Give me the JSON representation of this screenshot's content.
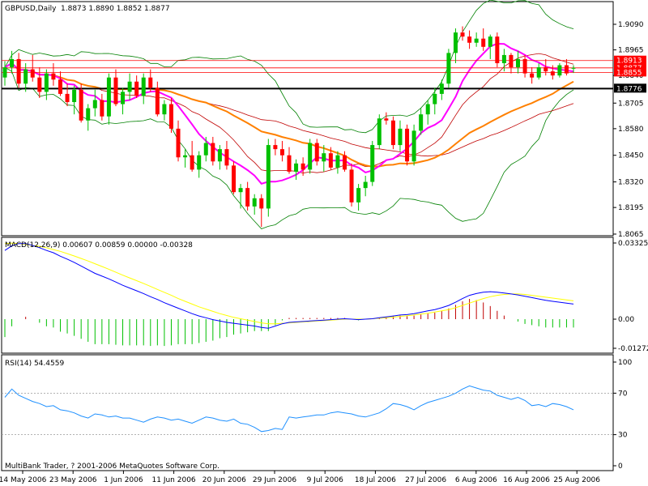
{
  "header": {
    "symbol_label": "GBPUSD,Daily",
    "ohlc_text": "1.8873 1.8890 1.8852 1.8877"
  },
  "footer": {
    "copyright": "MultiBank Trader, ? 2001-2006 MetaQuotes Software Corp."
  },
  "colors": {
    "background": "#ffffff",
    "bull": "#00c000",
    "bear": "#ff0000",
    "bb": "#008000",
    "ma_green": "#008000",
    "ma_magenta": "#ff00ff",
    "ma_orange": "#ff8000",
    "ma_red": "#c00000",
    "macd": "#0000ff",
    "signal": "#ffff00",
    "rsi": "#1e90ff",
    "hline": "#ff0000"
  },
  "chart_data": [
    {
      "type": "candlestick",
      "ylim": [
        1.8065,
        1.909
      ],
      "y_ticks": [
        "1.9090",
        "1.8965",
        "1.8840",
        "1.8705",
        "1.8580",
        "1.8450",
        "1.8320",
        "1.8195",
        "1.8065"
      ],
      "price_tags": {
        "top_red": "1.8913",
        "partial": "1.8877",
        "bottom_red": "1.8855",
        "black": "1.8776"
      },
      "red_lines": [
        1.8913,
        1.8877,
        1.8855
      ],
      "black_line": 1.8776,
      "x_dates": [
        "14 May 2006",
        "23 May 2006",
        "1 Jun 2006",
        "11 Jun 2006",
        "20 Jun 2006",
        "29 Jun 2006",
        "9 Jul 2006",
        "18 Jul 2006",
        "27 Jul 2006",
        "6 Aug 2006",
        "16 Aug 2006",
        "25 Aug 2006"
      ],
      "candles": [
        [
          1.883,
          1.891,
          1.879,
          1.888
        ],
        [
          1.888,
          1.896,
          1.885,
          1.892
        ],
        [
          1.892,
          1.895,
          1.878,
          1.88
        ],
        [
          1.88,
          1.89,
          1.876,
          1.887
        ],
        [
          1.887,
          1.894,
          1.881,
          1.883
        ],
        [
          1.883,
          1.888,
          1.873,
          1.876
        ],
        [
          1.876,
          1.887,
          1.872,
          1.885
        ],
        [
          1.885,
          1.89,
          1.879,
          1.882
        ],
        [
          1.882,
          1.886,
          1.874,
          1.875
        ],
        [
          1.875,
          1.88,
          1.869,
          1.871
        ],
        [
          1.871,
          1.879,
          1.865,
          1.877
        ],
        [
          1.877,
          1.88,
          1.861,
          1.862
        ],
        [
          1.862,
          1.87,
          1.857,
          1.868
        ],
        [
          1.868,
          1.877,
          1.864,
          1.872
        ],
        [
          1.872,
          1.875,
          1.862,
          1.864
        ],
        [
          1.864,
          1.885,
          1.86,
          1.883
        ],
        [
          1.883,
          1.887,
          1.869,
          1.87
        ],
        [
          1.87,
          1.878,
          1.865,
          1.876
        ],
        [
          1.876,
          1.885,
          1.872,
          1.881
        ],
        [
          1.881,
          1.884,
          1.873,
          1.874
        ],
        [
          1.874,
          1.885,
          1.87,
          1.883
        ],
        [
          1.883,
          1.887,
          1.876,
          1.878
        ],
        [
          1.878,
          1.881,
          1.864,
          1.865
        ],
        [
          1.865,
          1.872,
          1.862,
          1.87
        ],
        [
          1.87,
          1.873,
          1.856,
          1.858
        ],
        [
          1.858,
          1.862,
          1.842,
          1.844
        ],
        [
          1.844,
          1.848,
          1.839,
          1.845
        ],
        [
          1.845,
          1.852,
          1.837,
          1.838
        ],
        [
          1.838,
          1.847,
          1.834,
          1.845
        ],
        [
          1.845,
          1.854,
          1.842,
          1.851
        ],
        [
          1.851,
          1.854,
          1.84,
          1.842
        ],
        [
          1.842,
          1.85,
          1.838,
          1.848
        ],
        [
          1.848,
          1.852,
          1.838,
          1.84
        ],
        [
          1.84,
          1.842,
          1.826,
          1.827
        ],
        [
          1.827,
          1.831,
          1.819,
          1.829
        ],
        [
          1.829,
          1.832,
          1.818,
          1.82
        ],
        [
          1.82,
          1.826,
          1.816,
          1.824
        ],
        [
          1.824,
          1.826,
          1.81,
          1.819
        ],
        [
          1.819,
          1.853,
          1.815,
          1.85
        ],
        [
          1.85,
          1.853,
          1.845,
          1.848
        ],
        [
          1.848,
          1.852,
          1.842,
          1.845
        ],
        [
          1.845,
          1.849,
          1.836,
          1.837
        ],
        [
          1.837,
          1.843,
          1.833,
          1.841
        ],
        [
          1.841,
          1.844,
          1.835,
          1.838
        ],
        [
          1.838,
          1.853,
          1.836,
          1.851
        ],
        [
          1.851,
          1.853,
          1.84,
          1.842
        ],
        [
          1.842,
          1.85,
          1.837,
          1.846
        ],
        [
          1.846,
          1.849,
          1.838,
          1.839
        ],
        [
          1.839,
          1.847,
          1.836,
          1.845
        ],
        [
          1.845,
          1.847,
          1.837,
          1.838
        ],
        [
          1.838,
          1.841,
          1.82,
          1.822
        ],
        [
          1.822,
          1.831,
          1.818,
          1.829
        ],
        [
          1.829,
          1.835,
          1.825,
          1.832
        ],
        [
          1.832,
          1.852,
          1.83,
          1.85
        ],
        [
          1.85,
          1.865,
          1.848,
          1.863
        ],
        [
          1.863,
          1.866,
          1.86,
          1.862
        ],
        [
          1.862,
          1.864,
          1.848,
          1.85
        ],
        [
          1.85,
          1.862,
          1.847,
          1.858
        ],
        [
          1.858,
          1.86,
          1.84,
          1.842
        ],
        [
          1.842,
          1.86,
          1.84,
          1.857
        ],
        [
          1.857,
          1.868,
          1.855,
          1.865
        ],
        [
          1.865,
          1.872,
          1.86,
          1.87
        ],
        [
          1.87,
          1.878,
          1.865,
          1.875
        ],
        [
          1.875,
          1.882,
          1.872,
          1.88
        ],
        [
          1.88,
          1.897,
          1.878,
          1.895
        ],
        [
          1.895,
          1.907,
          1.89,
          1.905
        ],
        [
          1.905,
          1.908,
          1.901,
          1.903
        ],
        [
          1.903,
          1.906,
          1.897,
          1.9
        ],
        [
          1.9,
          1.905,
          1.898,
          1.902
        ],
        [
          1.902,
          1.907,
          1.896,
          1.898
        ],
        [
          1.898,
          1.904,
          1.892,
          1.903
        ],
        [
          1.903,
          1.905,
          1.888,
          1.89
        ],
        [
          1.89,
          1.897,
          1.886,
          1.894
        ],
        [
          1.894,
          1.895,
          1.885,
          1.888
        ],
        [
          1.888,
          1.896,
          1.885,
          1.892
        ],
        [
          1.892,
          1.894,
          1.883,
          1.885
        ],
        [
          1.885,
          1.888,
          1.88,
          1.883
        ],
        [
          1.883,
          1.89,
          1.882,
          1.888
        ],
        [
          1.888,
          1.892,
          1.884,
          1.886
        ],
        [
          1.886,
          1.889,
          1.882,
          1.884
        ],
        [
          1.884,
          1.89,
          1.883,
          1.889
        ],
        [
          1.889,
          1.892,
          1.884,
          1.885
        ],
        [
          1.8873,
          1.889,
          1.8852,
          1.8877
        ]
      ]
    },
    {
      "type": "line",
      "title": "MACD(12,26,9) 0.00607 0.00859 0.00000 -0.00328",
      "ylim": [
        -0.01272,
        0.03325
      ],
      "y_ticks": [
        "0.03325",
        "0.00",
        "-0.01272"
      ],
      "x_dates": [
        "14 May 2006",
        "23 May 2006",
        "1 Jun 2006",
        "11 Jun 2006",
        "20 Jun 2006",
        "29 Jun 2006",
        "9 Jul 2006",
        "18 Jul 2006",
        "27 Jul 2006",
        "6 Aug 2006",
        "16 Aug 2006",
        "25 Aug 2006"
      ],
      "series": [
        {
          "role": "macd",
          "values": [
            0.03,
            0.032,
            0.033,
            0.033,
            0.0322,
            0.0312,
            0.03,
            0.029,
            0.0275,
            0.0262,
            0.0248,
            0.0232,
            0.0216,
            0.02,
            0.0188,
            0.0176,
            0.0162,
            0.0148,
            0.0136,
            0.0124,
            0.0112,
            0.0098,
            0.0086,
            0.0072,
            0.006,
            0.0048,
            0.0036,
            0.0024,
            0.0014,
            0.0006,
            -0.0002,
            -0.0008,
            -0.0014,
            -0.0018,
            -0.0022,
            -0.0026,
            -0.003,
            -0.0036,
            -0.004,
            -0.003,
            -0.002,
            -0.0014,
            -0.0012,
            -0.001,
            -0.0008,
            -0.0006,
            -0.0004,
            -0.0002,
            0.0,
            0.0002,
            0.0,
            -0.0002,
            0.0,
            0.0002,
            0.0006,
            0.001,
            0.0014,
            0.0018,
            0.002,
            0.0024,
            0.003,
            0.0036,
            0.0042,
            0.005,
            0.006,
            0.0074,
            0.009,
            0.0104,
            0.0112,
            0.0118,
            0.012,
            0.0118,
            0.0114,
            0.011,
            0.0106,
            0.01,
            0.0094,
            0.0088,
            0.0082,
            0.0078,
            0.0074,
            0.007,
            0.0066
          ]
        },
        {
          "role": "signal",
          "values": [
            0.033,
            0.0332,
            0.033,
            0.0326,
            0.0322,
            0.0318,
            0.0312,
            0.0304,
            0.0296,
            0.0286,
            0.0276,
            0.0265,
            0.0254,
            0.0242,
            0.023,
            0.0218,
            0.0205,
            0.0192,
            0.018,
            0.0168,
            0.0156,
            0.0143,
            0.013,
            0.0117,
            0.0104,
            0.009,
            0.0078,
            0.0066,
            0.0054,
            0.0044,
            0.0034,
            0.0024,
            0.0016,
            0.0008,
            0.0002,
            -0.0004,
            -0.001,
            -0.0016,
            -0.002,
            -0.002,
            -0.0018,
            -0.0016,
            -0.0014,
            -0.0012,
            -0.001,
            -0.0008,
            -0.0006,
            -0.0004,
            -0.0002,
            0.0,
            0.0,
            0.0,
            0.0,
            0.0002,
            0.0004,
            0.0006,
            0.0009,
            0.0012,
            0.0015,
            0.0018,
            0.0022,
            0.0026,
            0.0031,
            0.0036,
            0.0042,
            0.005,
            0.006,
            0.007,
            0.008,
            0.009,
            0.0098,
            0.0104,
            0.0108,
            0.011,
            0.011,
            0.0108,
            0.0104,
            0.01,
            0.0096,
            0.0092,
            0.0088,
            0.0084,
            0.008
          ]
        }
      ]
    },
    {
      "type": "line",
      "title": "RSI(14) 54.4559",
      "ylim": [
        0,
        100
      ],
      "y_ticks": [
        "100",
        "70",
        "30",
        "0"
      ],
      "levels": [
        70,
        30
      ],
      "x_dates": [
        "14 May 2006",
        "23 May 2006",
        "1 Jun 2006",
        "11 Jun 2006",
        "20 Jun 2006",
        "29 Jun 2006",
        "9 Jul 2006",
        "18 Jul 2006",
        "27 Jul 2006",
        "6 Aug 2006",
        "16 Aug 2006",
        "25 Aug 2006"
      ],
      "series": [
        {
          "role": "rsi",
          "values": [
            66,
            74,
            68,
            65,
            62,
            60,
            57,
            58,
            54,
            53,
            51,
            48,
            46,
            50,
            49,
            47,
            48,
            46,
            46,
            44,
            42,
            45,
            47,
            46,
            44,
            45,
            43,
            41,
            44,
            47,
            46,
            44,
            43,
            45,
            41,
            40,
            37,
            33,
            34,
            36,
            35,
            47,
            46,
            47,
            48,
            49,
            49,
            51,
            52,
            51,
            50,
            48,
            47,
            49,
            51,
            55,
            60,
            59,
            57,
            54,
            58,
            61,
            63,
            65,
            67,
            70,
            74,
            77,
            75,
            73,
            72,
            68,
            66,
            64,
            66,
            63,
            58,
            59,
            57,
            60,
            59,
            57,
            54
          ]
        }
      ]
    }
  ]
}
